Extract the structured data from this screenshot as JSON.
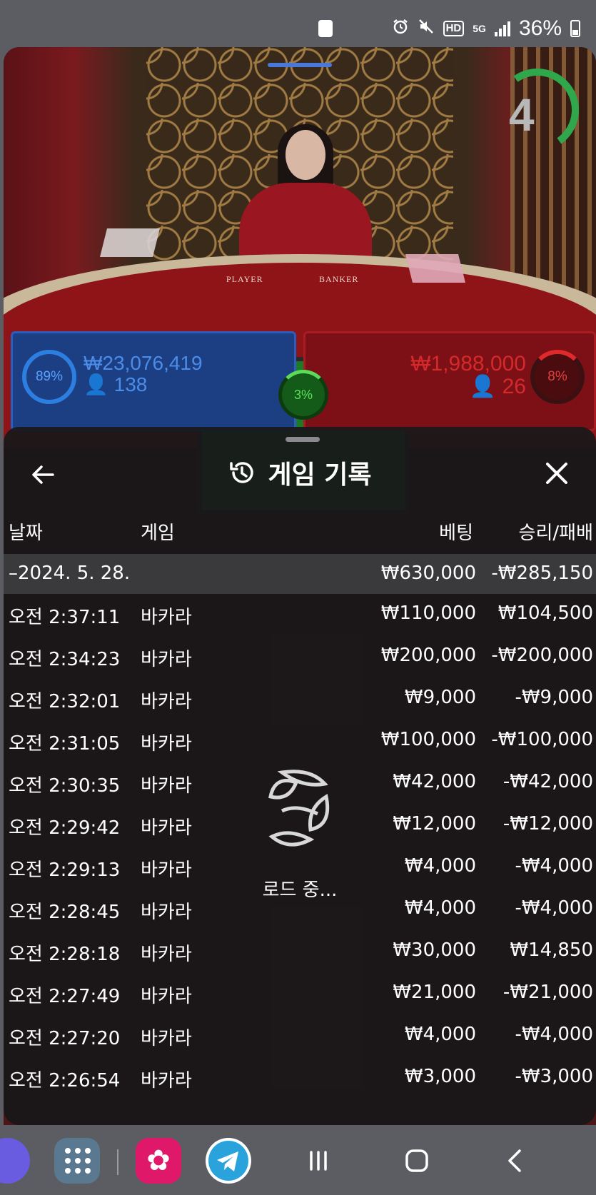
{
  "status_bar": {
    "battery_text": "36%",
    "icons": [
      "battery-saver-icon",
      "alarm-icon",
      "mute-icon",
      "hd-icon",
      "5g-icon",
      "signal-icon",
      "battery-icon"
    ],
    "hd_label": "HD",
    "net_label": "5G"
  },
  "game": {
    "timer": "4",
    "felt_player": "PLAYER",
    "felt_banker": "BANKER",
    "player": {
      "percent": "89%",
      "amount": "₩23,076,419",
      "players": "138"
    },
    "banker": {
      "percent": "8%",
      "amount": "₩1,988,000",
      "players": "26"
    },
    "tie": {
      "percent": "3%"
    },
    "colors": {
      "player": "#1c3f84",
      "banker": "#7c1016",
      "tie": "#1e7a24"
    }
  },
  "sheet": {
    "title": "게임 기록",
    "back_icon": "arrow-left-icon",
    "history_icon": "history-icon",
    "close_icon": "close-icon",
    "columns": {
      "date": "날짜",
      "game": "게임",
      "bet": "베팅",
      "result": "승리/패배"
    },
    "summary": {
      "date": "–2024. 5. 28.",
      "bet": "₩630,000",
      "result": "-₩285,150"
    },
    "rows": [
      {
        "time": "오전 2:37:11",
        "game": "바카라",
        "bet": "₩110,000",
        "result": "₩104,500"
      },
      {
        "time": "오전 2:34:23",
        "game": "바카라",
        "bet": "₩200,000",
        "result": "-₩200,000"
      },
      {
        "time": "오전 2:32:01",
        "game": "바카라",
        "bet": "₩9,000",
        "result": "-₩9,000"
      },
      {
        "time": "오전 2:31:05",
        "game": "바카라",
        "bet": "₩100,000",
        "result": "-₩100,000"
      },
      {
        "time": "오전 2:30:35",
        "game": "바카라",
        "bet": "₩42,000",
        "result": "-₩42,000"
      },
      {
        "time": "오전 2:29:42",
        "game": "바카라",
        "bet": "₩12,000",
        "result": "-₩12,000"
      },
      {
        "time": "오전 2:29:13",
        "game": "바카라",
        "bet": "₩4,000",
        "result": "-₩4,000"
      },
      {
        "time": "오전 2:28:45",
        "game": "바카라",
        "bet": "₩4,000",
        "result": "-₩4,000"
      },
      {
        "time": "오전 2:28:18",
        "game": "바카라",
        "bet": "₩30,000",
        "result": "₩14,850"
      },
      {
        "time": "오전 2:27:49",
        "game": "바카라",
        "bet": "₩21,000",
        "result": "-₩21,000"
      },
      {
        "time": "오전 2:27:20",
        "game": "바카라",
        "bet": "₩4,000",
        "result": "-₩4,000"
      },
      {
        "time": "오전 2:26:54",
        "game": "바카라",
        "bet": "₩3,000",
        "result": "-₩3,000"
      }
    ],
    "loading_text": "로드 중..."
  },
  "dock": {
    "apps": [
      "samsung-internet-icon",
      "app-drawer-icon",
      "gallery-flower-icon",
      "telegram-icon"
    ],
    "nav": [
      "recents-icon",
      "home-icon",
      "back-icon"
    ]
  }
}
